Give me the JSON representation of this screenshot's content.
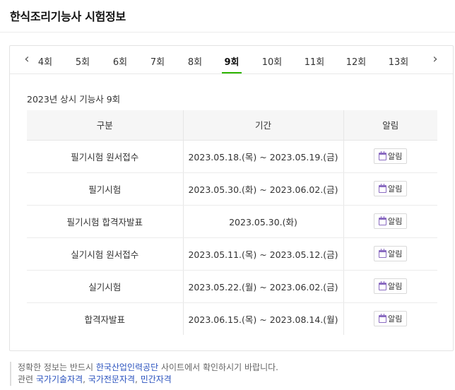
{
  "page": {
    "title": "한식조리기능사 시험정보"
  },
  "tabs": {
    "prev_icon": "chevron-left-icon",
    "next_icon": "chevron-right-icon",
    "items": [
      {
        "label": "4회",
        "active": false
      },
      {
        "label": "5회",
        "active": false
      },
      {
        "label": "6회",
        "active": false
      },
      {
        "label": "7회",
        "active": false
      },
      {
        "label": "8회",
        "active": false
      },
      {
        "label": "9회",
        "active": true
      },
      {
        "label": "10회",
        "active": false
      },
      {
        "label": "11회",
        "active": false
      },
      {
        "label": "12회",
        "active": false
      },
      {
        "label": "13회",
        "active": false
      }
    ],
    "accent_color": "#2db400"
  },
  "schedule": {
    "caption": "2023년 상시 기능사 9회",
    "headers": {
      "category": "구분",
      "period": "기간",
      "alarm": "알림"
    },
    "rows": [
      {
        "category": "필기시험 원서접수",
        "period": "2023.05.18.(목) ~ 2023.05.19.(금)",
        "alarm": "알림"
      },
      {
        "category": "필기시험",
        "period": "2023.05.30.(화) ~ 2023.06.02.(금)",
        "alarm": "알림"
      },
      {
        "category": "필기시험 합격자발표",
        "period": "2023.05.30.(화)",
        "alarm": "알림"
      },
      {
        "category": "실기시험 원서접수",
        "period": "2023.05.11.(목) ~ 2023.05.12.(금)",
        "alarm": "알림"
      },
      {
        "category": "실기시험",
        "period": "2023.05.22.(월) ~ 2023.06.02.(금)",
        "alarm": "알림"
      },
      {
        "category": "합격자발표",
        "period": "2023.06.15.(목) ~ 2023.08.14.(월)",
        "alarm": "알림"
      }
    ],
    "alarm_icon": "calendar-icon"
  },
  "notice": {
    "line1_prefix": "정확한 정보는 반드시 ",
    "line1_link": "한국산업인력공단",
    "line1_suffix": " 사이트에서 확인하시기 바랍니다.",
    "line2_prefix": "관련 ",
    "links": [
      "국가기술자격",
      "국가전문자격",
      "민간자격"
    ],
    "separator": ", ",
    "link_color": "#2a52be"
  }
}
